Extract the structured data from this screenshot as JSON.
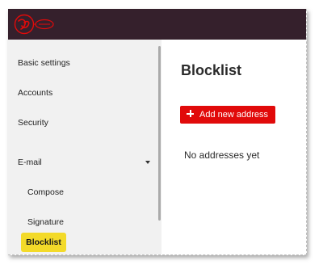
{
  "brand": {
    "logo_icon": "virgin-media-logo",
    "color": "#e10a0a"
  },
  "colors": {
    "topbar": "#35202c",
    "sidebar_bg": "#f1f1f1",
    "active_highlight": "#f3da29",
    "button_bg": "#e10a0a"
  },
  "sidebar": {
    "items": [
      {
        "label": "Basic settings"
      },
      {
        "label": "Accounts"
      },
      {
        "label": "Security"
      },
      {
        "label": "E-mail",
        "expanded": true,
        "icon": "chevron-down-icon"
      },
      {
        "label": "Compose"
      },
      {
        "label": "Signature"
      },
      {
        "label": "Blocklist",
        "active": true
      }
    ]
  },
  "main": {
    "title": "Blocklist",
    "add_button": {
      "icon": "plus-icon",
      "label": "Add new address"
    },
    "empty_message": "No addresses yet"
  }
}
